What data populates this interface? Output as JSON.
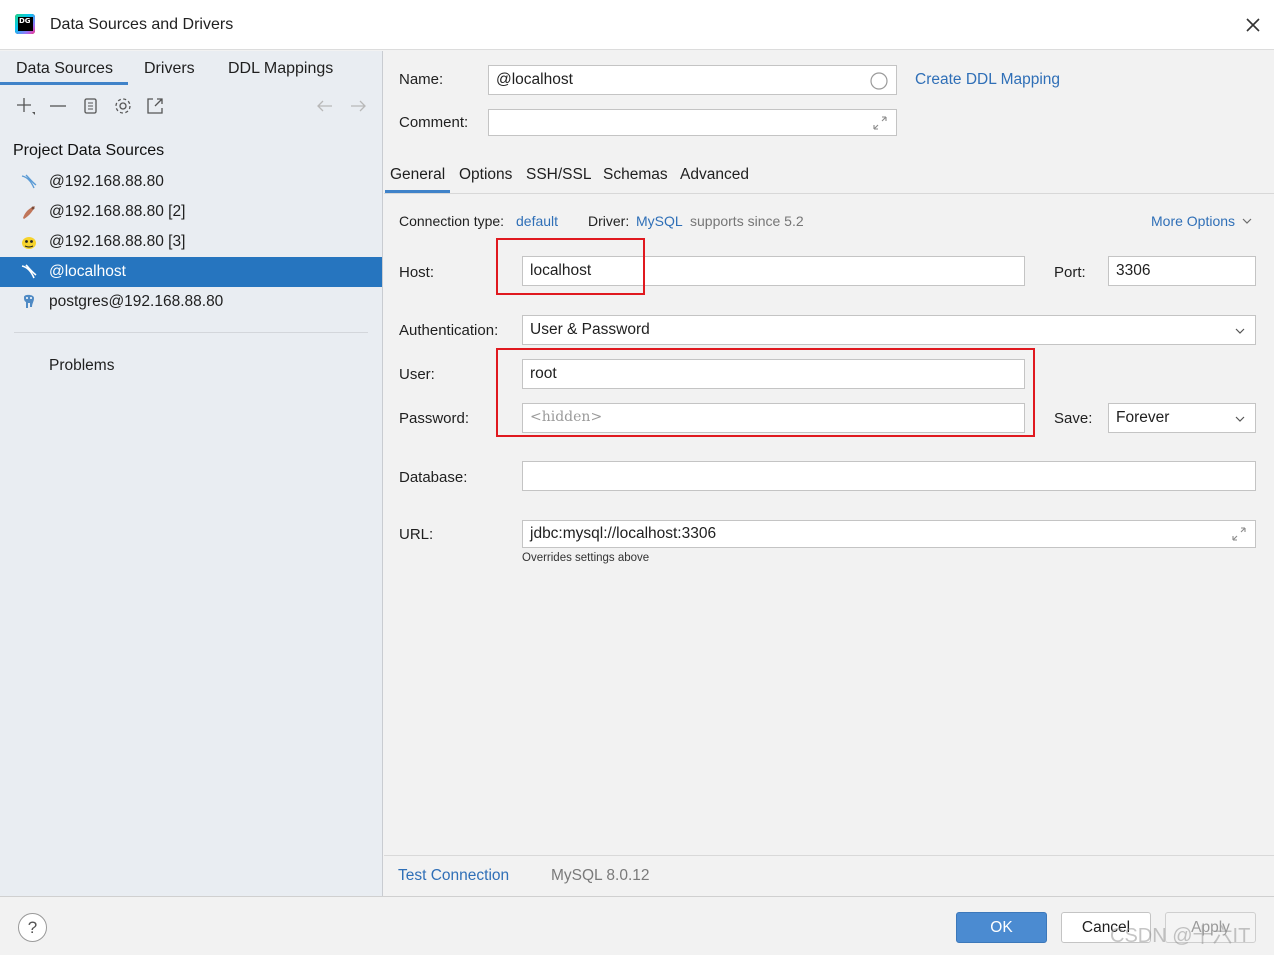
{
  "window": {
    "title": "Data Sources and Drivers"
  },
  "left": {
    "tabs": [
      "Data Sources",
      "Drivers",
      "DDL Mappings"
    ],
    "section_title": "Project Data Sources",
    "items": [
      {
        "label": "@192.168.88.80",
        "icon": "mysql-icon"
      },
      {
        "label": "@192.168.88.80 [2]",
        "icon": "mariadb-icon"
      },
      {
        "label": "@192.168.88.80 [3]",
        "icon": "hive-icon"
      },
      {
        "label": "@localhost",
        "icon": "mysql-icon"
      },
      {
        "label": "postgres@192.168.88.80",
        "icon": "postgres-icon"
      }
    ],
    "problems": "Problems"
  },
  "form": {
    "name_label": "Name:",
    "name_value": "@localhost",
    "create_ddl": "Create DDL Mapping",
    "comment_label": "Comment:",
    "comment_value": "",
    "tabs": [
      "General",
      "Options",
      "SSH/SSL",
      "Schemas",
      "Advanced"
    ],
    "connection_type_label": "Connection type:",
    "connection_type_value": "default",
    "driver_label": "Driver:",
    "driver_value": "MySQL",
    "driver_note": "supports since 5.2",
    "more_options": "More Options",
    "host_label": "Host:",
    "host_value": "localhost",
    "port_label": "Port:",
    "port_value": "3306",
    "auth_label": "Authentication:",
    "auth_value": "User & Password",
    "user_label": "User:",
    "user_value": "root",
    "password_label": "Password:",
    "password_placeholder": "<hidden>",
    "save_label": "Save:",
    "save_value": "Forever",
    "database_label": "Database:",
    "database_value": "",
    "url_label": "URL:",
    "url_value": "jdbc:mysql://localhost:3306",
    "url_note": "Overrides settings above",
    "test_connection": "Test Connection",
    "server_version": "MySQL 8.0.12"
  },
  "footer": {
    "help": "?",
    "ok": "OK",
    "cancel": "Cancel",
    "apply": "Apply",
    "watermark": "CSDN @十六IT"
  },
  "colors": {
    "accent": "#2675bf",
    "link": "#2f6fb7",
    "highlight_box": "#e0191f"
  }
}
